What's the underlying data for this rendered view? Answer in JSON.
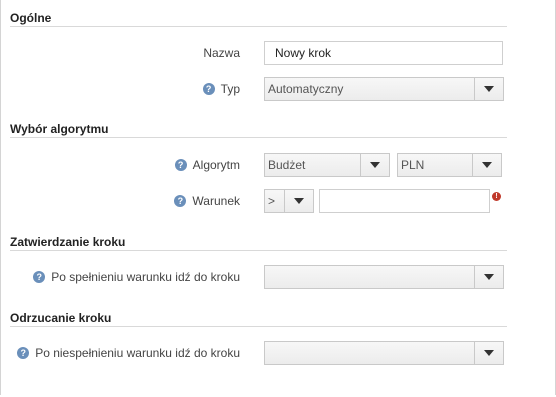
{
  "sections": {
    "general": {
      "title": "Ogólne",
      "name_label": "Nazwa",
      "name_value": "Nowy krok",
      "type_label": "Typ",
      "type_value": "Automatyczny"
    },
    "algorithm": {
      "title": "Wybór algorytmu",
      "algorithm_label": "Algorytm",
      "algorithm_value": "Budżet",
      "currency_value": "PLN",
      "condition_label": "Warunek",
      "operator_value": ">",
      "condition_value": ""
    },
    "accept": {
      "title": "Zatwierdzanie kroku",
      "goto_label": "Po spełnieniu warunku idź do kroku",
      "goto_value": ""
    },
    "reject": {
      "title": "Odrzucanie kroku",
      "goto_label": "Po niespełnieniu warunku idź do kroku",
      "goto_value": ""
    }
  },
  "icons": {
    "help": "question-circle-icon",
    "error": "exclamation-circle-icon",
    "dropdown": "caret-down-icon"
  },
  "colors": {
    "help_icon": "#6a8fba",
    "error_icon": "#c0392b"
  }
}
